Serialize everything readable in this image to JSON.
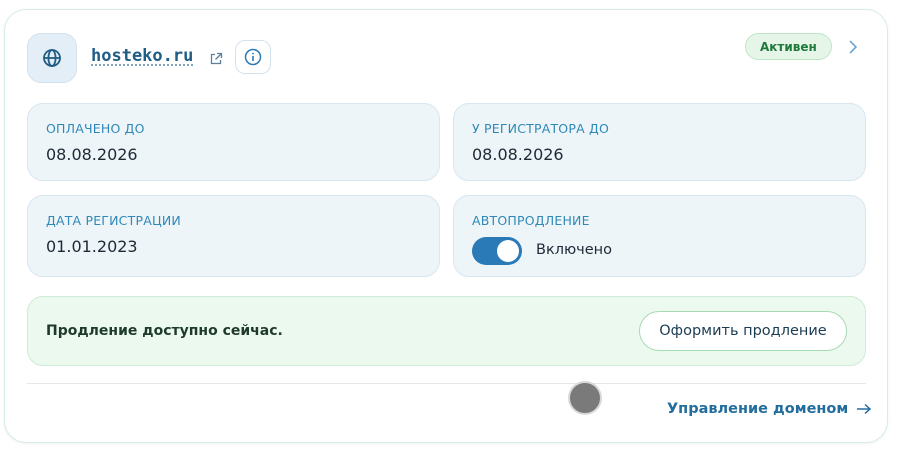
{
  "header": {
    "domain": "hosteko.ru",
    "status": "Активен",
    "icons": {
      "globe": "globe-icon",
      "external": "external-link-icon",
      "info": "info-icon",
      "chevron": "chevron-right-icon"
    }
  },
  "tiles": {
    "paid_until": {
      "label": "ОПЛАЧЕНО ДО",
      "value": "08.08.2026"
    },
    "registrar_until": {
      "label": "У РЕГИСТРАТОРА ДО",
      "value": "08.08.2026"
    },
    "registered": {
      "label": "ДАТА РЕГИСТРАЦИИ",
      "value": "01.01.2023"
    },
    "autorenew": {
      "label": "АВТОПРОДЛЕНИЕ",
      "state_text": "Включено",
      "enabled": true
    }
  },
  "renewal": {
    "message": "Продление доступно сейчас.",
    "button_label": "Оформить продление"
  },
  "footer": {
    "manage_label": "Управление доменом",
    "arrow_icon": "arrow-right-icon"
  },
  "colors": {
    "accent": "#2a7ab8",
    "status_green": "#1f7a3a",
    "renew_bg": "#ecf9ef"
  }
}
